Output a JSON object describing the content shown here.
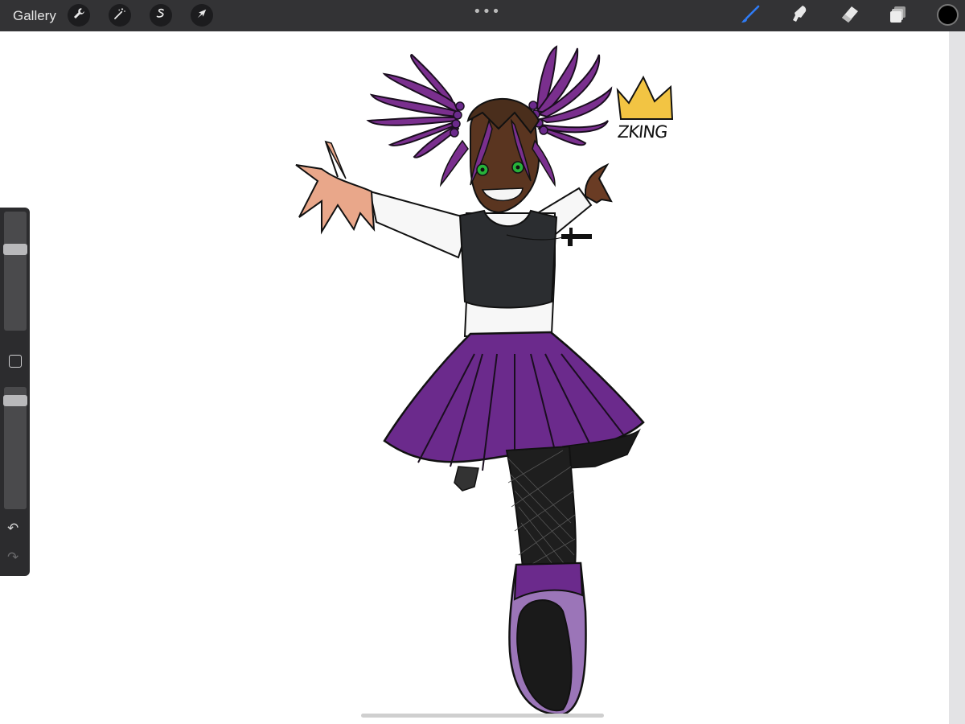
{
  "app": {
    "gallery_label": "Gallery"
  },
  "toolbar_left": [
    {
      "icon": "wrench-icon",
      "label": "Actions"
    },
    {
      "icon": "magic-wand-icon",
      "label": "Adjustments"
    },
    {
      "icon": "selection-s-icon",
      "label": "Selection"
    },
    {
      "icon": "arrow-cursor-icon",
      "label": "Transform"
    }
  ],
  "more_menu": "•••",
  "toolbar_right": [
    {
      "icon": "brush-icon",
      "active": true
    },
    {
      "icon": "smudge-icon",
      "active": false
    },
    {
      "icon": "eraser-icon",
      "active": false
    },
    {
      "icon": "layers-icon",
      "active": false
    }
  ],
  "current_color": "#000000",
  "accent_color": "#2f7cf6",
  "sidebar": {
    "brush_size_level": 0.7,
    "opacity_level": 0.93,
    "undo_glyph": "↶",
    "redo_glyph": "↷"
  },
  "artwork": {
    "signature": "ZKING",
    "colors": {
      "hair": "#7a2f8e",
      "skirt": "#6b2a8c",
      "skin": "#5a3520",
      "vest": "#2b2d30",
      "crown": "#f2c443"
    }
  }
}
